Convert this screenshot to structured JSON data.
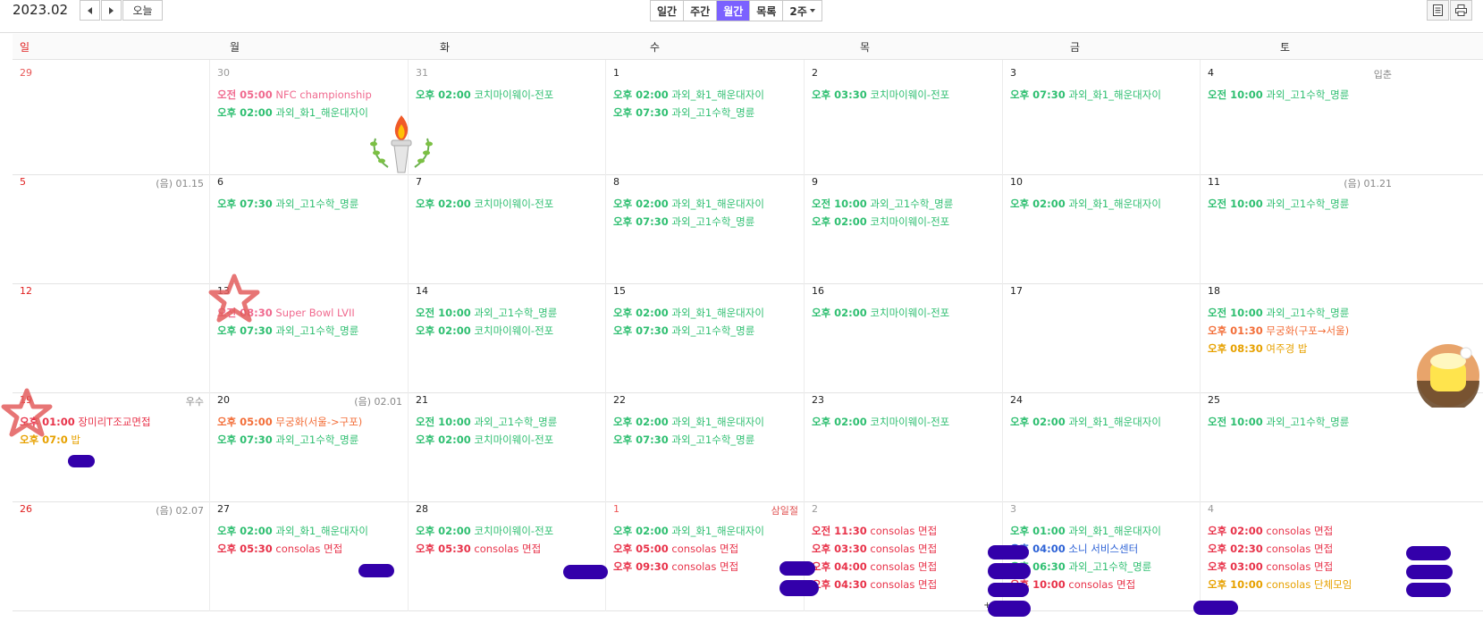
{
  "header": {
    "month": "2023.02",
    "today_label": "오늘",
    "views": [
      "일간",
      "주간",
      "월간",
      "목록",
      "2주"
    ],
    "active_view": "월간"
  },
  "weekdays": [
    "일",
    "월",
    "화",
    "수",
    "목",
    "금",
    "토"
  ],
  "colors": {
    "accent": "#7b61ff",
    "green": "#2fbf71",
    "red": "#e8334a",
    "salmon": "#f36f3a",
    "orange": "#e7a100",
    "pink": "#f06a8f",
    "blue": "#2e63d6",
    "sunday": "#e02020",
    "redact": "#3300aa"
  },
  "weeks": [
    [
      {
        "day": "29",
        "kind": "other-sun",
        "events": []
      },
      {
        "day": "30",
        "kind": "other",
        "events": [
          {
            "time": "오전 05:00",
            "title": "NFC championship",
            "color": "pink"
          },
          {
            "time": "오후 02:00",
            "title": "과외_화1_해운대자이",
            "color": "green"
          }
        ]
      },
      {
        "day": "31",
        "kind": "other",
        "events": [
          {
            "time": "오후 02:00",
            "title": "코치마이웨이-전포",
            "color": "green"
          }
        ]
      },
      {
        "day": "1",
        "events": [
          {
            "time": "오후 02:00",
            "title": "과외_화1_해운대자이",
            "color": "green"
          },
          {
            "time": "오후 07:30",
            "title": "과외_고1수학_명륜",
            "color": "green"
          }
        ]
      },
      {
        "day": "2",
        "events": [
          {
            "time": "오후 03:30",
            "title": "코치마이웨이-전포",
            "color": "green"
          }
        ]
      },
      {
        "day": "3",
        "events": [
          {
            "time": "오후 07:30",
            "title": "과외_화1_해운대자이",
            "color": "green"
          }
        ]
      },
      {
        "day": "4",
        "note": "입춘",
        "events": [
          {
            "time": "오전 10:00",
            "title": "과외_고1수학_명륜",
            "color": "green"
          }
        ]
      }
    ],
    [
      {
        "day": "5",
        "kind": "sun",
        "note": "(음) 01.15",
        "events": []
      },
      {
        "day": "6",
        "events": [
          {
            "time": "오후 07:30",
            "title": "과외_고1수학_명륜",
            "color": "green"
          }
        ]
      },
      {
        "day": "7",
        "events": [
          {
            "time": "오후 02:00",
            "title": "코치마이웨이-전포",
            "color": "green"
          }
        ]
      },
      {
        "day": "8",
        "events": [
          {
            "time": "오후 02:00",
            "title": "과외_화1_해운대자이",
            "color": "green"
          },
          {
            "time": "오후 07:30",
            "title": "과외_고1수학_명륜",
            "color": "green"
          }
        ]
      },
      {
        "day": "9",
        "events": [
          {
            "time": "오전 10:00",
            "title": "과외_고1수학_명륜",
            "color": "green"
          },
          {
            "time": "오후 02:00",
            "title": "코치마이웨이-전포",
            "color": "green"
          }
        ]
      },
      {
        "day": "10",
        "events": [
          {
            "time": "오후 02:00",
            "title": "과외_화1_해운대자이",
            "color": "green"
          }
        ]
      },
      {
        "day": "11",
        "note": "(음) 01.21",
        "events": [
          {
            "time": "오전 10:00",
            "title": "과외_고1수학_명륜",
            "color": "green"
          }
        ]
      }
    ],
    [
      {
        "day": "12",
        "kind": "sun",
        "events": []
      },
      {
        "day": "13",
        "events": [
          {
            "time": "오전 08:30",
            "title": "Super Bowl LVII",
            "color": "pink"
          },
          {
            "time": "오후 07:30",
            "title": "과외_고1수학_명륜",
            "color": "green"
          }
        ]
      },
      {
        "day": "14",
        "events": [
          {
            "time": "오전 10:00",
            "title": "과외_고1수학_명륜",
            "color": "green"
          },
          {
            "time": "오후 02:00",
            "title": "코치마이웨이-전포",
            "color": "green"
          }
        ]
      },
      {
        "day": "15",
        "events": [
          {
            "time": "오후 02:00",
            "title": "과외_화1_해운대자이",
            "color": "green"
          },
          {
            "time": "오후 07:30",
            "title": "과외_고1수학_명륜",
            "color": "green"
          }
        ]
      },
      {
        "day": "16",
        "events": [
          {
            "time": "오후 02:00",
            "title": "코치마이웨이-전포",
            "color": "green"
          }
        ]
      },
      {
        "day": "17",
        "events": []
      },
      {
        "day": "18",
        "events": [
          {
            "time": "오전 10:00",
            "title": "과외_고1수학_명륜",
            "color": "green"
          },
          {
            "time": "오후 01:30",
            "title": "무궁화(구포→서울)",
            "color": "salmon"
          },
          {
            "time": "오후 08:30",
            "title": "여주경 밥",
            "color": "orange"
          }
        ]
      }
    ],
    [
      {
        "day": "19",
        "kind": "sun",
        "note": "우수",
        "events": [
          {
            "time": "오후 01:00",
            "title": "장미리T조교면접",
            "color": "red"
          },
          {
            "time": "오후 07:0",
            "title": "밥",
            "color": "orange"
          }
        ]
      },
      {
        "day": "20",
        "note": "(음) 02.01",
        "events": [
          {
            "time": "오후 05:00",
            "title": "무궁화(서울->구포)",
            "color": "salmon"
          },
          {
            "time": "오후 07:30",
            "title": "과외_고1수학_명륜",
            "color": "green"
          }
        ]
      },
      {
        "day": "21",
        "events": [
          {
            "time": "오전 10:00",
            "title": "과외_고1수학_명륜",
            "color": "green"
          },
          {
            "time": "오후 02:00",
            "title": "코치마이웨이-전포",
            "color": "green"
          }
        ]
      },
      {
        "day": "22",
        "events": [
          {
            "time": "오후 02:00",
            "title": "과외_화1_해운대자이",
            "color": "green"
          },
          {
            "time": "오후 07:30",
            "title": "과외_고1수학_명륜",
            "color": "green"
          }
        ]
      },
      {
        "day": "23",
        "events": [
          {
            "time": "오후 02:00",
            "title": "코치마이웨이-전포",
            "color": "green"
          }
        ]
      },
      {
        "day": "24",
        "events": [
          {
            "time": "오후 02:00",
            "title": "과외_화1_해운대자이",
            "color": "green"
          }
        ]
      },
      {
        "day": "25",
        "events": [
          {
            "time": "오전 10:00",
            "title": "과외_고1수학_명륜",
            "color": "green"
          }
        ]
      }
    ],
    [
      {
        "day": "26",
        "kind": "sun",
        "note": "(음) 02.07",
        "events": []
      },
      {
        "day": "27",
        "events": [
          {
            "time": "오후 02:00",
            "title": "과외_화1_해운대자이",
            "color": "green"
          },
          {
            "time": "오후 05:30",
            "title": "consolas 면접",
            "color": "red"
          }
        ]
      },
      {
        "day": "28",
        "events": [
          {
            "time": "오후 02:00",
            "title": "코치마이웨이-전포",
            "color": "green"
          },
          {
            "time": "오후 05:30",
            "title": "consolas 면접",
            "color": "red"
          }
        ]
      },
      {
        "day": "1",
        "kind": "holiday",
        "note": "삼일절",
        "noteRed": true,
        "events": [
          {
            "time": "오후 02:00",
            "title": "과외_화1_해운대자이",
            "color": "green"
          },
          {
            "time": "오후 05:00",
            "title": "consolas 면접",
            "color": "red"
          },
          {
            "time": "오후 09:30",
            "title": "consolas 면접",
            "color": "red"
          }
        ]
      },
      {
        "day": "2",
        "kind": "other",
        "more": "+1",
        "events": [
          {
            "time": "오전 11:30",
            "title": "consolas 면접",
            "color": "red"
          },
          {
            "time": "오후 03:30",
            "title": "consolas 면접",
            "color": "red"
          },
          {
            "time": "오후 04:00",
            "title": "consolas 면접",
            "color": "red"
          },
          {
            "time": "오후 04:30",
            "title": "consolas 면접",
            "color": "red"
          }
        ]
      },
      {
        "day": "3",
        "kind": "other",
        "events": [
          {
            "time": "오후 01:00",
            "title": "과외_화1_해운대자이",
            "color": "green"
          },
          {
            "time": "오후 04:00",
            "title": "소니 서비스센터",
            "color": "blue"
          },
          {
            "time": "오후 06:30",
            "title": "과외_고1수학_명륜",
            "color": "green"
          },
          {
            "time": "오후 10:00",
            "title": "consolas 면접",
            "color": "red"
          }
        ]
      },
      {
        "day": "4",
        "kind": "other",
        "events": [
          {
            "time": "오후 02:00",
            "title": "consolas 면접",
            "color": "red"
          },
          {
            "time": "오후 02:30",
            "title": "consolas 면접",
            "color": "red"
          },
          {
            "time": "오후 03:00",
            "title": "consolas 면접",
            "color": "red"
          },
          {
            "time": "오후 10:00",
            "title": "consolas 단체모임",
            "color": "orange"
          }
        ]
      }
    ]
  ]
}
